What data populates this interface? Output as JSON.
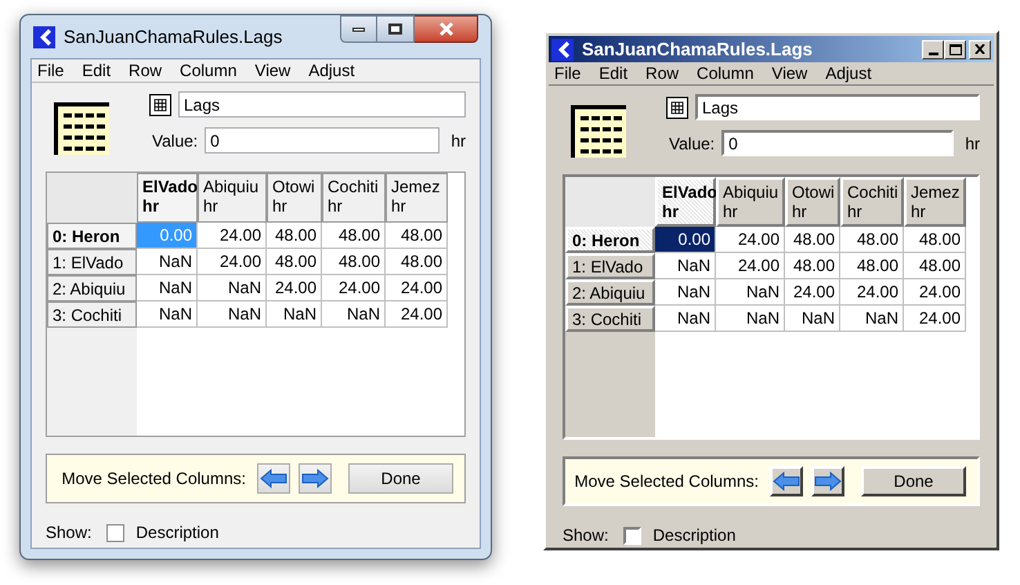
{
  "windows": [
    {
      "kind": "aero",
      "title": "SanJuanChamaRules.Lags",
      "menu": [
        "File",
        "Edit",
        "Row",
        "Column",
        "View",
        "Adjust"
      ],
      "name_field": "Lags",
      "value_label": "Value:",
      "value": "0",
      "unit": "hr",
      "table": {
        "columns": [
          {
            "name": "ElVado",
            "unit": "hr",
            "selected": true
          },
          {
            "name": "Abiquiu",
            "unit": "hr",
            "selected": false
          },
          {
            "name": "Otowi",
            "unit": "hr",
            "selected": false
          },
          {
            "name": "Cochiti",
            "unit": "hr",
            "selected": false
          },
          {
            "name": "Jemez",
            "unit": "hr",
            "selected": false
          }
        ],
        "rows": [
          {
            "label": "0: Heron",
            "selected": true,
            "cells": [
              {
                "text": "0.00",
                "selected": true
              },
              {
                "text": "24.00",
                "selected": false
              },
              {
                "text": "48.00",
                "selected": false
              },
              {
                "text": "48.00",
                "selected": false
              },
              {
                "text": "48.00",
                "selected": false
              }
            ]
          },
          {
            "label": "1: ElVado",
            "selected": false,
            "cells": [
              {
                "text": "NaN",
                "selected": false
              },
              {
                "text": "24.00",
                "selected": false
              },
              {
                "text": "48.00",
                "selected": false
              },
              {
                "text": "48.00",
                "selected": false
              },
              {
                "text": "48.00",
                "selected": false
              }
            ]
          },
          {
            "label": "2: Abiquiu",
            "selected": false,
            "cells": [
              {
                "text": "NaN",
                "selected": false
              },
              {
                "text": "NaN",
                "selected": false
              },
              {
                "text": "24.00",
                "selected": false
              },
              {
                "text": "24.00",
                "selected": false
              },
              {
                "text": "24.00",
                "selected": false
              }
            ]
          },
          {
            "label": "3: Cochiti",
            "selected": false,
            "cells": [
              {
                "text": "NaN",
                "selected": false
              },
              {
                "text": "NaN",
                "selected": false
              },
              {
                "text": "NaN",
                "selected": false
              },
              {
                "text": "NaN",
                "selected": false
              },
              {
                "text": "24.00",
                "selected": false
              }
            ]
          }
        ]
      },
      "move_label": "Move Selected Columns:",
      "done": "Done",
      "show_label": "Show:",
      "description": {
        "label": "Description",
        "checked": false
      }
    },
    {
      "kind": "classic",
      "title": "SanJuanChamaRules.Lags",
      "menu": [
        "File",
        "Edit",
        "Row",
        "Column",
        "View",
        "Adjust"
      ],
      "name_field": "Lags",
      "value_label": "Value:",
      "value": "0",
      "unit": "hr",
      "table": {
        "columns": [
          {
            "name": "ElVado",
            "unit": "hr",
            "selected": true
          },
          {
            "name": "Abiquiu",
            "unit": "hr",
            "selected": false
          },
          {
            "name": "Otowi",
            "unit": "hr",
            "selected": false
          },
          {
            "name": "Cochiti",
            "unit": "hr",
            "selected": false
          },
          {
            "name": "Jemez",
            "unit": "hr",
            "selected": false
          }
        ],
        "rows": [
          {
            "label": "0: Heron",
            "selected": true,
            "cells": [
              {
                "text": "0.00",
                "selected": true
              },
              {
                "text": "24.00",
                "selected": false
              },
              {
                "text": "48.00",
                "selected": false
              },
              {
                "text": "48.00",
                "selected": false
              },
              {
                "text": "48.00",
                "selected": false
              }
            ]
          },
          {
            "label": "1: ElVado",
            "selected": false,
            "cells": [
              {
                "text": "NaN",
                "selected": false
              },
              {
                "text": "24.00",
                "selected": false
              },
              {
                "text": "48.00",
                "selected": false
              },
              {
                "text": "48.00",
                "selected": false
              },
              {
                "text": "48.00",
                "selected": false
              }
            ]
          },
          {
            "label": "2: Abiquiu",
            "selected": false,
            "cells": [
              {
                "text": "NaN",
                "selected": false
              },
              {
                "text": "NaN",
                "selected": false
              },
              {
                "text": "24.00",
                "selected": false
              },
              {
                "text": "24.00",
                "selected": false
              },
              {
                "text": "24.00",
                "selected": false
              }
            ]
          },
          {
            "label": "3: Cochiti",
            "selected": false,
            "cells": [
              {
                "text": "NaN",
                "selected": false
              },
              {
                "text": "NaN",
                "selected": false
              },
              {
                "text": "NaN",
                "selected": false
              },
              {
                "text": "NaN",
                "selected": false
              },
              {
                "text": "24.00",
                "selected": false
              }
            ]
          }
        ]
      },
      "move_label": "Move Selected Columns:",
      "done": "Done",
      "show_label": "Show:",
      "description": {
        "label": "Description",
        "checked": false
      }
    }
  ]
}
